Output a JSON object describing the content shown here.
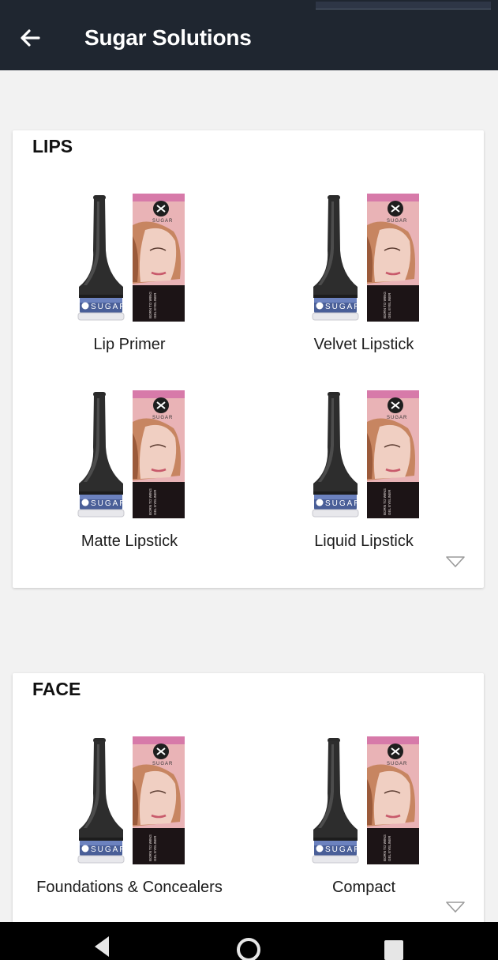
{
  "app_bar": {
    "title": "Sugar Solutions",
    "back_icon": "arrow-left-icon"
  },
  "sections": [
    {
      "title": "LIPS",
      "items": [
        {
          "label": "Lip Primer"
        },
        {
          "label": "Velvet Lipstick"
        },
        {
          "label": "Matte Lipstick"
        },
        {
          "label": "Liquid Lipstick"
        }
      ],
      "expand_icon": "triangle-down-icon"
    },
    {
      "title": "FACE",
      "items": [
        {
          "label": "Foundations & Concealers"
        },
        {
          "label": "Compact"
        }
      ],
      "expand_icon": "triangle-down-icon"
    }
  ],
  "product_image": {
    "brand_text": "SUGAR",
    "box_text": "BORN TO WING GEL EYELINER"
  },
  "nav_bar": {
    "buttons": [
      "back-triangle-icon",
      "home-circle-icon",
      "recents-square-icon"
    ]
  },
  "colors": {
    "app_bar": "#1f2630",
    "background": "#f2f2f2",
    "card": "#ffffff",
    "nav_bar": "#000000"
  }
}
